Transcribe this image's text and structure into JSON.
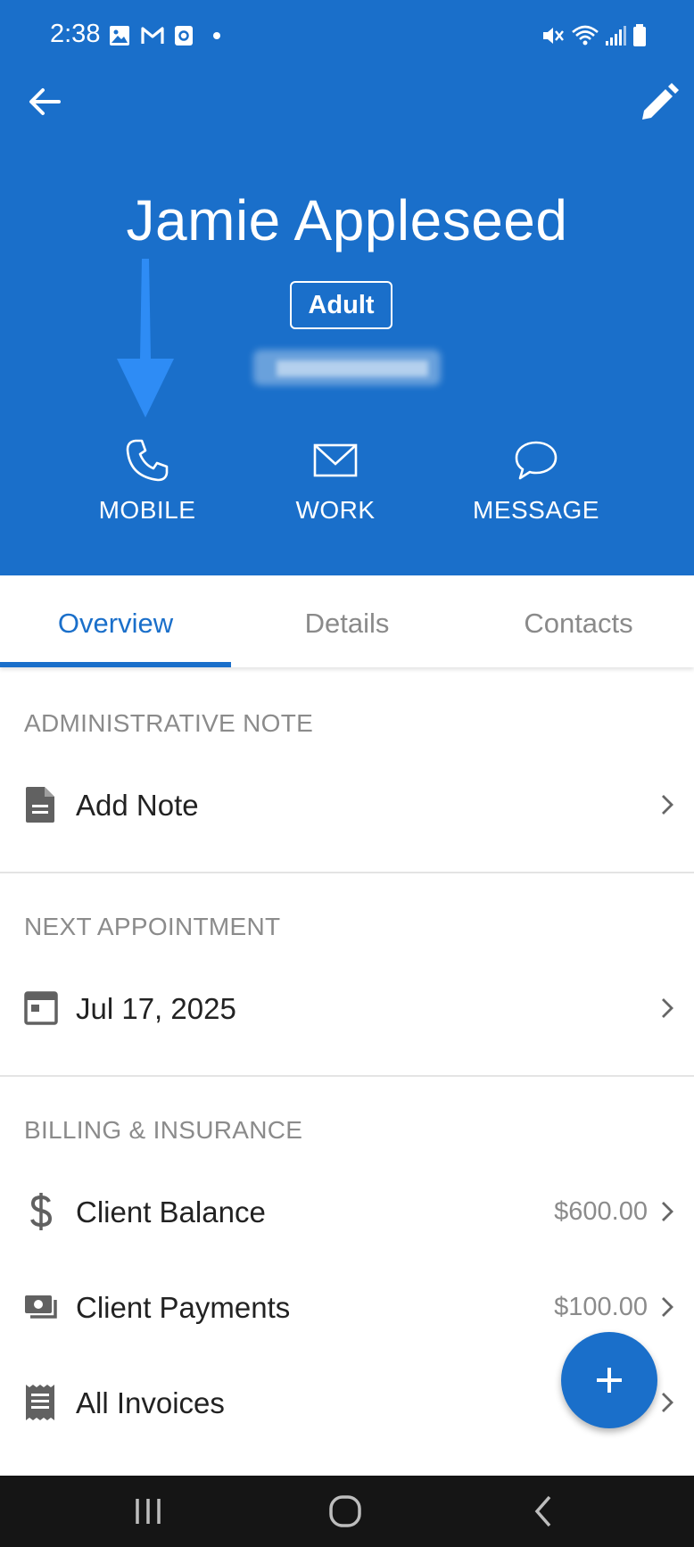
{
  "status_bar": {
    "time": "2:38"
  },
  "header": {
    "client_name": "Jamie Appleseed",
    "badge": "Adult",
    "actions": [
      {
        "label": "MOBILE",
        "icon": "phone-icon"
      },
      {
        "label": "WORK",
        "icon": "mail-icon"
      },
      {
        "label": "MESSAGE",
        "icon": "chat-bubble-icon"
      }
    ]
  },
  "tabs": [
    {
      "label": "Overview",
      "active": true
    },
    {
      "label": "Details",
      "active": false
    },
    {
      "label": "Contacts",
      "active": false
    }
  ],
  "sections": {
    "admin_note": {
      "title": "ADMINISTRATIVE NOTE",
      "row_label": "Add Note",
      "icon": "document-icon"
    },
    "next_appointment": {
      "title": "NEXT APPOINTMENT",
      "row_label": "Jul 17, 2025",
      "icon": "calendar-icon"
    },
    "billing": {
      "title": "BILLING & INSURANCE",
      "rows": [
        {
          "label": "Client Balance",
          "value": "$600.00",
          "icon": "dollar-icon"
        },
        {
          "label": "Client Payments",
          "value": "$100.00",
          "icon": "payments-icon"
        },
        {
          "label": "All Invoices",
          "value": "",
          "icon": "receipt-icon"
        }
      ]
    }
  },
  "colors": {
    "primary": "#1a6fca",
    "annotation_arrow": "#2e8cf5"
  }
}
